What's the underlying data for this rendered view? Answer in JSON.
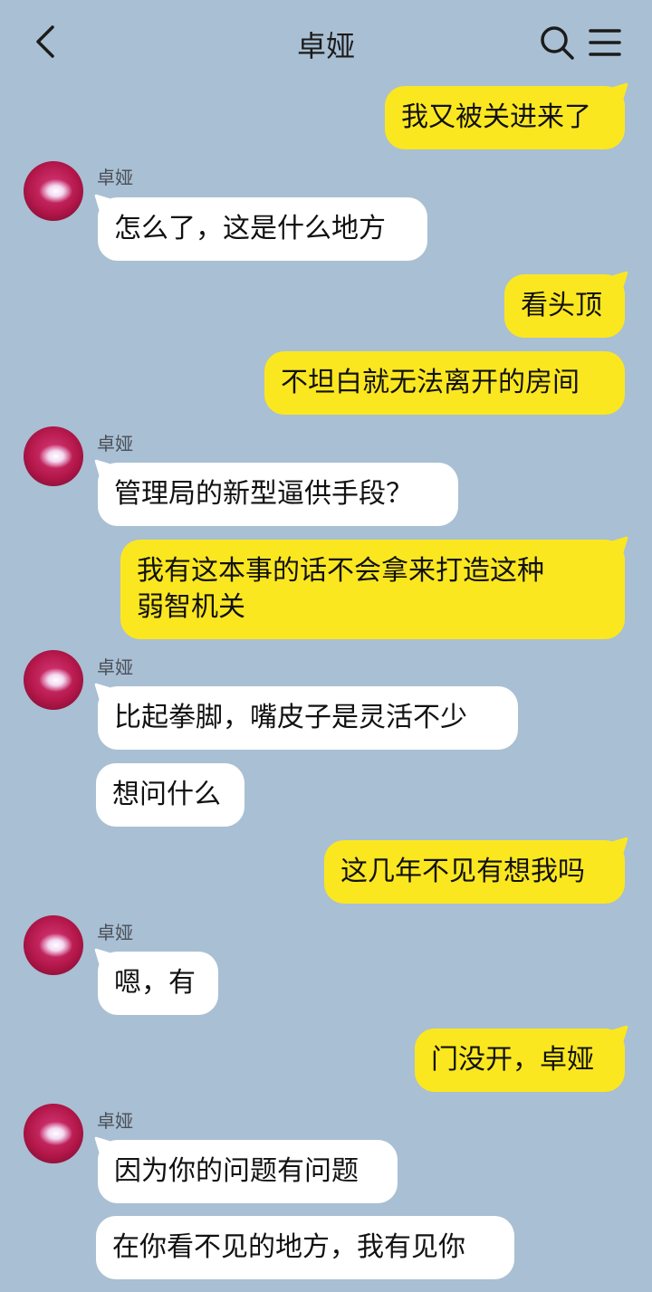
{
  "header": {
    "title": "卓娅"
  },
  "contact": {
    "name": "卓娅"
  },
  "messages": [
    {
      "side": "out",
      "text": "我又被关进来了"
    },
    {
      "side": "in",
      "sender": "卓娅",
      "text": "怎么了，这是什么地方"
    },
    {
      "side": "out",
      "text": "看头顶"
    },
    {
      "side": "out",
      "text": "不坦白就无法离开的房间"
    },
    {
      "side": "in",
      "sender": "卓娅",
      "text": "管理局的新型逼供手段？"
    },
    {
      "side": "out",
      "text": "我有这本事的话不会拿来打造这种弱智机关",
      "line1": "我有这本事的话不会拿来打造这种",
      "line2": "弱智机关"
    },
    {
      "side": "in",
      "sender": "卓娅",
      "text": "比起拳脚，嘴皮子是灵活不少"
    },
    {
      "side": "in",
      "text": "想问什么"
    },
    {
      "side": "out",
      "text": "这几年不见有想我吗"
    },
    {
      "side": "in",
      "sender": "卓娅",
      "text": "嗯，有"
    },
    {
      "side": "out",
      "text": "门没开，卓娅"
    },
    {
      "side": "in",
      "sender": "卓娅",
      "text": "因为你的问题有问题"
    },
    {
      "side": "in",
      "text": "在你看不见的地方，我有见你"
    }
  ],
  "icons": {
    "back": "chevron-left-icon",
    "search": "search-icon",
    "menu": "menu-icon"
  },
  "colors": {
    "background": "#a9bfd3",
    "outgoing_bubble": "#fbe720",
    "incoming_bubble": "#ffffff"
  }
}
